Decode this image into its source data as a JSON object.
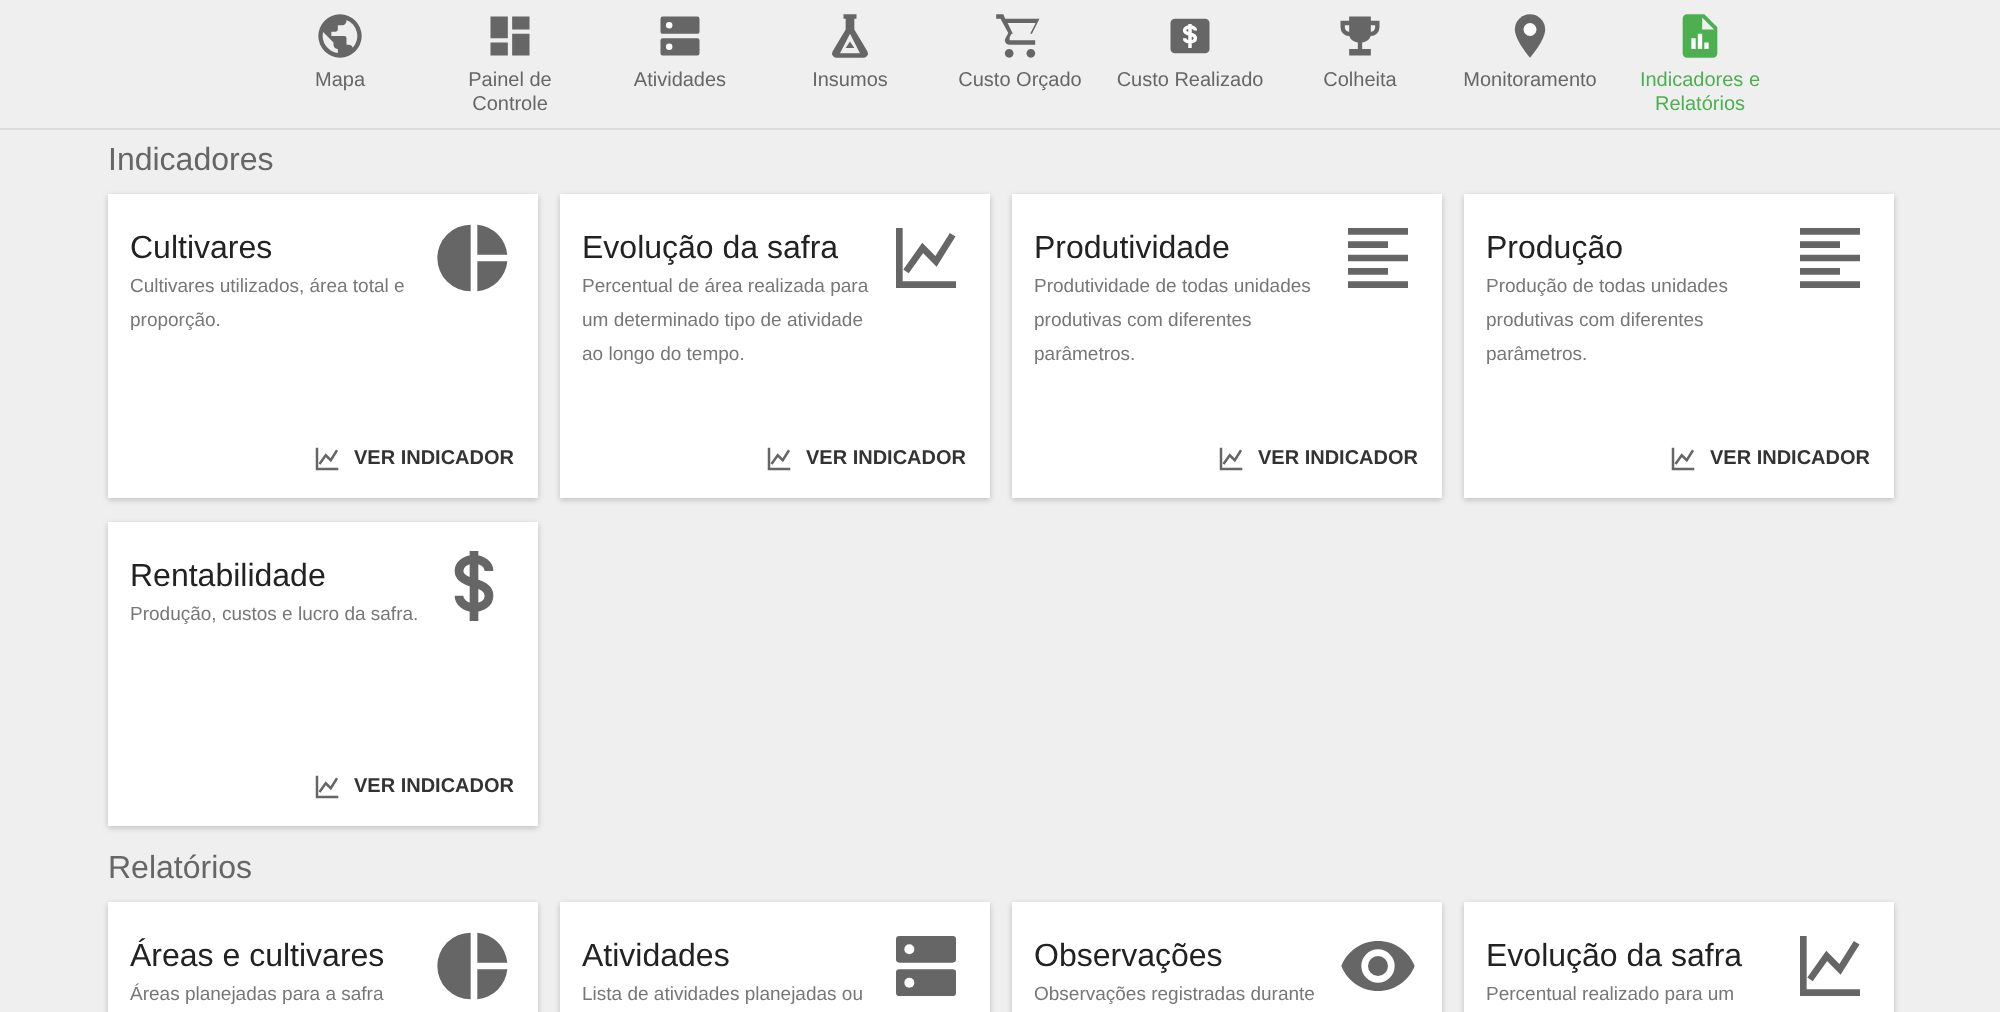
{
  "nav": [
    {
      "label": "Mapa",
      "kind": "globe",
      "selected": false
    },
    {
      "label": "Painel de Controle",
      "kind": "dashboard",
      "selected": false
    },
    {
      "label": "Atividades",
      "kind": "server",
      "selected": false
    },
    {
      "label": "Insumos",
      "kind": "flask",
      "selected": false
    },
    {
      "label": "Custo Orçado",
      "kind": "cart",
      "selected": false
    },
    {
      "label": "Custo Realizado",
      "kind": "money",
      "selected": false
    },
    {
      "label": "Colheita",
      "kind": "trophy",
      "selected": false
    },
    {
      "label": "Monitoramento",
      "kind": "pin",
      "selected": false
    },
    {
      "label": "Indicadores e Relatórios",
      "kind": "report",
      "selected": true
    }
  ],
  "sections": [
    {
      "title": "Indicadores",
      "cards": [
        {
          "title": "Cultivares",
          "description": "Cultivares utilizados, área total e proporção.",
          "kind": "pie",
          "action": "VER INDICADOR"
        },
        {
          "title": "Evolução da safra",
          "description": "Percentual de área realizada para um determinado tipo de atividade ao longo do tempo.",
          "kind": "chart",
          "action": "VER INDICADOR"
        },
        {
          "title": "Produtividade",
          "description": "Produtividade de todas unidades produtivas com diferentes parâmetros.",
          "kind": "lines",
          "action": "VER INDICADOR"
        },
        {
          "title": "Produção",
          "description": "Produção de todas unidades produtivas com diferentes parâmetros.",
          "kind": "lines",
          "action": "VER INDICADOR"
        },
        {
          "title": "Rentabilidade",
          "description": "Produção, custos e lucro da safra.",
          "kind": "dollar",
          "action": "VER INDICADOR"
        }
      ]
    },
    {
      "title": "Relatórios",
      "cards": [
        {
          "title": "Áreas e cultivares",
          "description": "Áreas planejadas para a safra",
          "kind": "pie"
        },
        {
          "title": "Atividades",
          "description": "Lista de atividades planejadas ou",
          "kind": "server"
        },
        {
          "title": "Observações",
          "description": "Observações registradas durante",
          "kind": "eye"
        },
        {
          "title": "Evolução da safra",
          "description": "Percentual realizado para um",
          "kind": "chart"
        }
      ]
    }
  ]
}
